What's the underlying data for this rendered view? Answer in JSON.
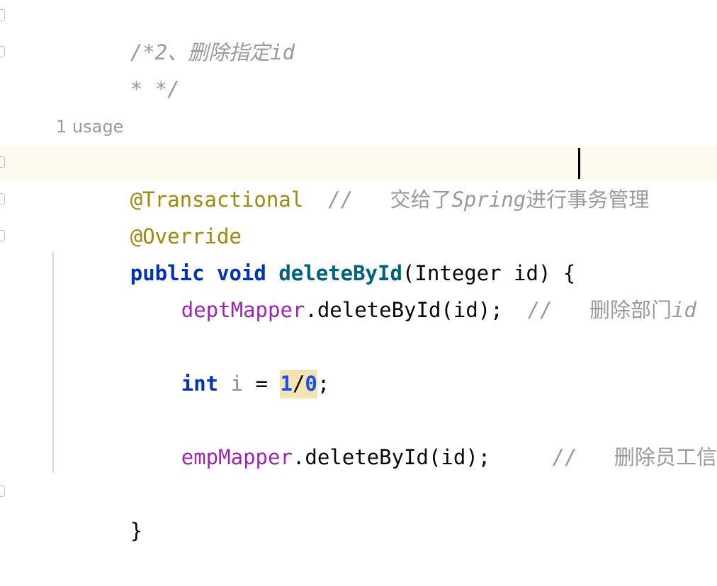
{
  "editor": {
    "theme_background": "#ffffff",
    "current_line_highlight_color": "#fdfbf0",
    "error_highlight_color": "#f5e3b3",
    "indent_guide_color": "#d8d8d8",
    "caret_color": "#000000",
    "colors": {
      "comment": "#9a9a9a",
      "annotation": "#9e880d",
      "keyword": "#0033b3",
      "method": "#00627a",
      "field": "#9b27b0",
      "number": "#1750eb",
      "plain": "#080808",
      "unused_variable": "#8c8c8c"
    }
  },
  "inlay_hints": {
    "usage_hint": "1 usage"
  },
  "code": {
    "line1": {
      "comment_open": "/*2、删除指定",
      "comment_italic_tail": "id"
    },
    "line2": {
      "comment_close": "* */"
    },
    "line_transactional": {
      "annotation": "@Transactional",
      "gap": "  ",
      "comment_slashes": "//",
      "comment_space": "   ",
      "comment_cn_a": "交给了",
      "comment_en": "Spring",
      "comment_cn_b": "进行事务管理"
    },
    "line_override": {
      "annotation": "@Override"
    },
    "line_signature": {
      "modifier": "public",
      "space1": " ",
      "return_type": "void",
      "space2": " ",
      "method_name": "deleteById",
      "params": "(Integer id) {"
    },
    "line_dept": {
      "field": "deptMapper",
      "call": ".deleteById(id);",
      "gap": "  ",
      "comment_slashes": "//",
      "comment_space": "   ",
      "comment_cn": "删除部门",
      "comment_italic_tail": "id"
    },
    "line_divzero": {
      "keyword": "int",
      "space1": " ",
      "variable": "i",
      "operator": " = ",
      "numerator": "1",
      "divider": "/",
      "denominator": "0",
      "terminator": ";"
    },
    "line_emp": {
      "field": "empMapper",
      "call": ".deleteById(id);",
      "gap": "     ",
      "comment_slashes": "//",
      "comment_space": "   ",
      "comment_cn": "删除员工信息"
    },
    "line_close": {
      "brace": "}"
    }
  }
}
